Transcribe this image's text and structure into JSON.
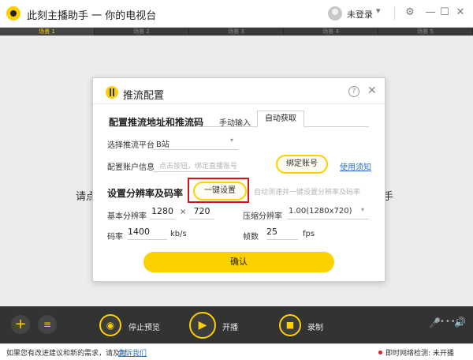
{
  "window": {
    "title": "此刻主播助手 一 你的电视台",
    "user_login": "未登录"
  },
  "icons": {
    "user_chevron": "▾",
    "settings": "⚙",
    "minimize": "—",
    "maximize": "☐",
    "close": "✕"
  },
  "scenes": [
    "场景 1",
    "场景 2",
    "场景 3",
    "场景 4",
    "场景 5"
  ],
  "canvas": {
    "hint_left": "请点",
    "hint_right": "手"
  },
  "dialog": {
    "title": "推流配置",
    "help": "?",
    "close": "✕",
    "section1_title": "配置推流地址和推流码",
    "tab_manual": "手动输入",
    "tab_auto": "自动获取",
    "platform_label": "选择推流平台",
    "platform_value": "B站",
    "account_label": "配置账户信息",
    "account_placeholder": "点击按钮，绑定直播账号",
    "bind_button": "绑定账号",
    "usage_link": "使用须知",
    "section2_title": "设置分辨率及码率",
    "oneclick_button": "一键设置",
    "oneclick_hint": "自动测速并一键设置分辨率及码率",
    "base_res_label": "基本分辨率",
    "res_width": "1280",
    "res_x": "×",
    "res_height": "720",
    "compress_label": "压缩分辨率",
    "compress_value": "1.00(1280x720)",
    "bitrate_label": "码率",
    "bitrate_value": "1400",
    "bitrate_unit": "kb/s",
    "fps_label": "帧数",
    "fps_value": "25",
    "fps_unit": "fps",
    "confirm_button": "确认"
  },
  "toolbar": {
    "add": "+",
    "layers": "≡",
    "preview_label": "停止预览",
    "live_label": "开播",
    "record_label": "录制",
    "vol_dots": "••••",
    "preview_icon": "◉",
    "live_icon": "▶",
    "record_icon": "■",
    "mic_icon": "🎤",
    "speaker_icon": "🔊"
  },
  "status": {
    "feedback_text": "如果您有改进建议和新的需求，请及时",
    "feedback_link": "告诉我们",
    "network_text": "即时网络检测: 未开播"
  },
  "colors": {
    "accent": "#fdd000",
    "highlight_border": "#d7131a",
    "link": "#2a74d8"
  }
}
